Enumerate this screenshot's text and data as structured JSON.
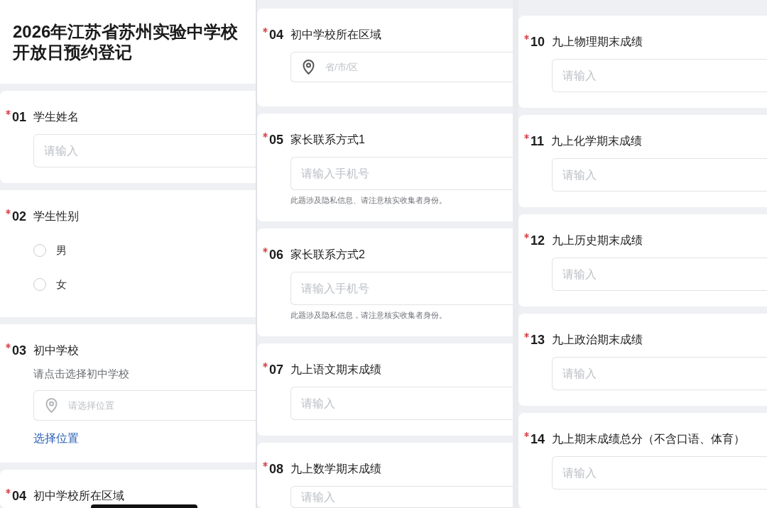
{
  "columns": [
    {
      "cards": [
        {
          "kind": "title",
          "lines": [
            "2026年江苏省苏州实验中学校",
            "开放日预约登记"
          ]
        },
        {
          "kind": "text",
          "required": true,
          "number": "01",
          "label": "学生姓名",
          "placeholder": "请输入"
        },
        {
          "kind": "radio",
          "required": true,
          "number": "02",
          "label": "学生性别",
          "options": [
            {
              "label": "男",
              "selected": false
            },
            {
              "label": "女",
              "selected": false
            }
          ]
        },
        {
          "kind": "location",
          "required": true,
          "number": "03",
          "label": "初中学校",
          "description": "请点击选择初中学校",
          "placeholder": "请选择位置",
          "link": "选择位置"
        },
        {
          "kind": "region",
          "required": true,
          "number": "04",
          "label": "初中学校所在区域"
        }
      ]
    },
    {
      "cards": [
        {
          "kind": "region",
          "required": true,
          "number": "04",
          "label": "初中学校所在区域",
          "placeholder": "省/市/区"
        },
        {
          "kind": "text",
          "required": true,
          "number": "05",
          "label": "家长联系方式1",
          "placeholder": "请输入手机号",
          "hint": "此题涉及隐私信息、请注意核实收集者身份。"
        },
        {
          "kind": "text",
          "required": true,
          "number": "06",
          "label": "家长联系方式2",
          "placeholder": "请输入手机号",
          "hint": "此题涉及隐私信息，请注意核实收集者身份。"
        },
        {
          "kind": "text",
          "required": true,
          "number": "07",
          "label": "九上语文期末成绩",
          "placeholder": "请输入"
        },
        {
          "kind": "text",
          "required": true,
          "number": "08",
          "label": "九上数学期末成绩",
          "placeholder": "请输入"
        }
      ]
    },
    {
      "cards": [
        {
          "kind": "text",
          "required": true,
          "number": "10",
          "label": "九上物理期末成绩",
          "placeholder": "请输入"
        },
        {
          "kind": "text",
          "required": true,
          "number": "11",
          "label": "九上化学期末成绩",
          "placeholder": "请输入"
        },
        {
          "kind": "text",
          "required": true,
          "number": "12",
          "label": "九上历史期末成绩",
          "placeholder": "请输入"
        },
        {
          "kind": "text",
          "required": true,
          "number": "13",
          "label": "九上政治期末成绩",
          "placeholder": "请输入"
        },
        {
          "kind": "text",
          "required": true,
          "number": "14",
          "label": "九上期末成绩总分（不含口语、体育）",
          "placeholder": "请输入"
        }
      ]
    }
  ]
}
